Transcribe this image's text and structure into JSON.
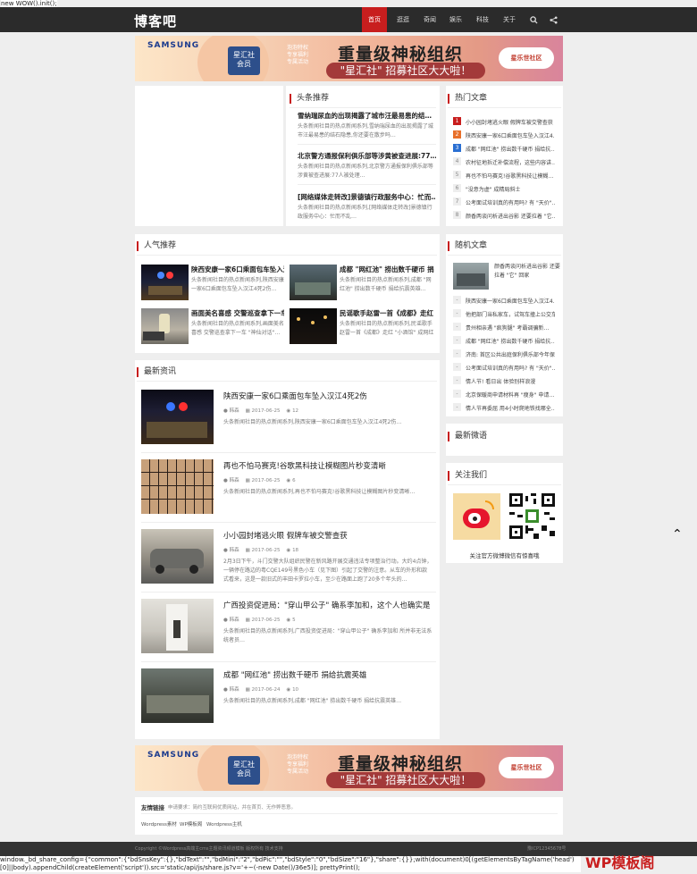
{
  "top_code": "new WOW().init();",
  "logo": "博客吧",
  "nav": [
    "首页",
    "逛逛",
    "奇闻",
    "娱乐",
    "科技",
    "关于"
  ],
  "banner": {
    "brand": "SAMSUNG",
    "card": "星汇社\n会员",
    "small": "泡泡特权\n专享福利\n专属活动",
    "title": "重量级神秘组织",
    "sub": "\"星汇社\" 招募社区大大啦！",
    "club": "星乐世社区"
  },
  "headline": {
    "title": "头条推荐",
    "items": [
      {
        "title": "雪纳瑞尿血的出现揭露了城市汪最易患的结…",
        "desc": "头条新闻社目的热点新闻系列,雪纳瑞尿血的出现揭露了城市汪最易患的结石隐患,你还要在散步吗…"
      },
      {
        "title": "北京警方通报保利俱乐部等涉黄被查进展:77…",
        "desc": "头条新闻社目的热点新闻系列,北京警方通报保利俱乐部等涉黄被查进展:77人被处理…"
      },
      {
        "title": "[网络媒体走转改]景德镇行政服务中心：忙而…",
        "desc": "头条新闻社目的热点新闻系列,[网络媒体走转改]景德镇行政服务中心：忙而不乱…"
      }
    ]
  },
  "hot": {
    "title": "热门文章",
    "items": [
      "小小园封堵逃火眼 假牌车被交警查获",
      "陕西安康一家6口乘面包车坠入汉江4…",
      "成都 \"网红池\" 捞出数千硬币 捐给抗…",
      "农村征地拆迁补偿流程，这些内容讲…",
      "再也不怕马赛克!谷歌黑科技让模糊…",
      "\"没意为虚\" 成精局斜士",
      "公考面试培训真的有用吗? 有 \"天价\"…",
      "颜香两谈问析进出谷影 还要拉着 \"它…"
    ]
  },
  "popular": {
    "title": "人气推荐",
    "items": [
      {
        "title": "陕西安康一家6口乘面包车坠入汉…",
        "desc": "头条新闻社目的热点新闻系列,陕西安康一家6口乘面包车坠入汉江4死2伤…"
      },
      {
        "title": "成都 \"网红池\" 捞出数千硬币 捐…",
        "desc": "头条新闻社目的热点新闻系列,成都 \"网红池\" 捞出数千硬币 捐给抗震英雄…"
      },
      {
        "title": "画面美名喜感 交警巡查拿下一车…",
        "desc": "头条新闻社目的热点新闻系列,画面美名喜感 交警巡查拿下一车 \"神仙对话\"…"
      },
      {
        "title": "民谣歌手赵雷一首《成都》走红 …",
        "desc": "头条新闻社目的热点新闻系列,民谣歌手赵雷一首《成都》走红 \"小酒馆\" 成网红游地标…"
      }
    ]
  },
  "random": {
    "title": "随机文章",
    "feature": "颜香两谈问析进出谷影 还要拉着 \"它\" 回家",
    "items": [
      "陕西安康一家6口乘面包车坠入汉江4…",
      "他把部门当私家车，试驾车撞上公交车",
      "贵州相亲遇 \"疯狗腿\" 考霸调骗新…",
      "成都 \"网红池\" 捞出数千硬币 捐给抗…",
      "济南: 首区公共出庭保利俱乐部今年保…",
      "公考面试培训真的有用吗? 有 \"天价\"…",
      "情人节! 看日出 体验别样浪漫",
      "北京保暖商申请材料再 \"瘦身\" 申请…",
      "情人节再委屈 用4小时爬地铁找哪全…"
    ]
  },
  "latest": {
    "title": "最新资讯",
    "items": [
      {
        "title": "陕西安康一家6口乘面包车坠入汉江4死2伤",
        "author": "韩森",
        "date": "2017-06-25",
        "views": "12",
        "desc": "头条新闻社目的热点新闻系列,陕西安康一家6口乘面包车坠入汉江4死2伤…"
      },
      {
        "title": "再也不怕马赛克!谷歌黑科技让模糊图片秒变清晰",
        "author": "韩森",
        "date": "2017-06-25",
        "views": "6",
        "desc": "头条新闻社目的热点新闻系列,再也不怕马赛克!谷歌黑科技让模糊图片秒变清晰…"
      },
      {
        "title": "小小园封堵逃火眼 假牌车被交警查获",
        "author": "韩森",
        "date": "2017-06-25",
        "views": "18",
        "desc": "2月3日下午，斗门交警大队组织民警在新风路开展交通违法专项整治行动。大约4点钟，一辆停在路边的粤CQE149号黑色小车（见下图）引起了交警的注意。从车的外形和款式看来，这是一款旧式的丰田卡罗拉小车，至少在路面上跑了20多个年头的…"
      },
      {
        "title": "广西投资促进局：\"穿山甲公子\" 确系李加和，这个人也确实是",
        "author": "韩森",
        "date": "2017-06-25",
        "views": "5",
        "desc": "头条新闻社目的热点新闻系列,广西投资促进局：\"穿山甲公子\" 确系李加和 所并非无法系统者员…"
      },
      {
        "title": "成都 \"网红池\" 捞出数千硬币 捐给抗震英雄",
        "author": "韩森",
        "date": "2017-06-24",
        "views": "10",
        "desc": "头条新闻社目的热点新闻系列,成都 \"网红池\" 捞出数千硬币 捐给抗震英雄…"
      }
    ]
  },
  "weibo": {
    "title": "最新微语"
  },
  "follow": {
    "title": "关注我们",
    "caption": "关注官方微博微信有惊喜哦"
  },
  "links": {
    "label": "友情链接",
    "note": "申请要求：简约互联网优质网站，并在首页、无作弊恶意。",
    "items": [
      "Wordpress素材",
      "WP模板阁",
      "Wordpress主机"
    ]
  },
  "footer": {
    "copyright": "Copyright ©Wordpress高端主cms主题资讯频道模板 版权所有 技术支持",
    "icp": "豫ICP12345678号"
  },
  "bottom_code": "window._bd_share_config={\"common\":{\"bdSnsKey\":{},\"bdText\":\"\",\"bdMini\":\"2\",\"bdPic\":\"\",\"bdStyle\":\"0\",\"bdSize\":\"16\"},\"share\":{}};with(document)0[(getElementsByTagName('head')[0]||body).appendChild(createElement('script')).src='static/api/js/share.js?v='+~(-new Date()/36e5)]; prettyPrint();",
  "wp_logo": "WP模板阁"
}
